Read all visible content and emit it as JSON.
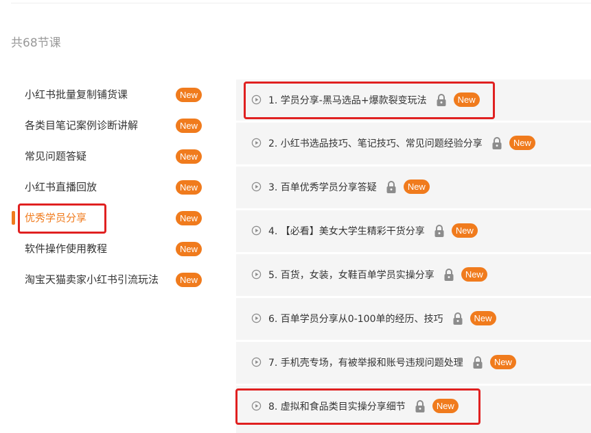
{
  "course": {
    "count_label": "共68节课"
  },
  "badge_label": "New",
  "colors": {
    "accent": "#f07b1d",
    "highlight": "#e02020",
    "panel_bg": "#f5f5f5"
  },
  "sidebar": {
    "items": [
      {
        "label": "小红书批量复制铺货课"
      },
      {
        "label": "各类目笔记案例诊断讲解"
      },
      {
        "label": "常见问题答疑"
      },
      {
        "label": "小红书直播回放"
      },
      {
        "label": "优秀学员分享",
        "active": true
      },
      {
        "label": "软件操作使用教程"
      },
      {
        "label": "淘宝天猫卖家小红书引流玩法"
      }
    ]
  },
  "lessons": [
    {
      "title": "1. 学员分享-黑马选品+爆款裂变玩法"
    },
    {
      "title": "2. 小红书选品技巧、笔记技巧、常见问题经验分享"
    },
    {
      "title": "3. 百单优秀学员分享答疑"
    },
    {
      "title": "4. 【必看】美女大学生精彩干货分享"
    },
    {
      "title": "5. 百货，女装，女鞋百单学员实操分享"
    },
    {
      "title": "6. 百单学员分享从0-100单的经历、技巧"
    },
    {
      "title": "7. 手机壳专场，有被举报和账号违规问题处理"
    },
    {
      "title": "8. 虚拟和食品类目实操分享细节"
    }
  ],
  "icons": {
    "play": "play-circle-icon",
    "lock": "lock-icon"
  }
}
